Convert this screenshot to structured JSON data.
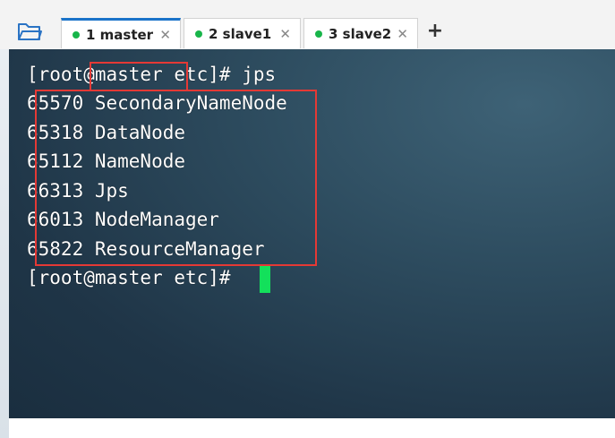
{
  "tabs": [
    {
      "label": "1 master",
      "active": true,
      "status_color": "#18b54a",
      "close": "✕"
    },
    {
      "label": "2 slave1",
      "active": false,
      "status_color": "#18b54a",
      "close": "✕"
    },
    {
      "label": "3 slave2",
      "active": false,
      "status_color": "#18b54a",
      "close": "✕"
    }
  ],
  "add_tab_label": "+",
  "terminal": {
    "command_line": "[root@master etc]# jps",
    "processes": [
      "65570 SecondaryNameNode",
      "65318 DataNode",
      "65112 NameNode",
      "66313 Jps",
      "66013 NodeManager",
      "65822 ResourceManager"
    ],
    "prompt_line": "[root@master etc]# ",
    "cursor_color": "#13e05b",
    "highlight_color": "#e53935"
  }
}
